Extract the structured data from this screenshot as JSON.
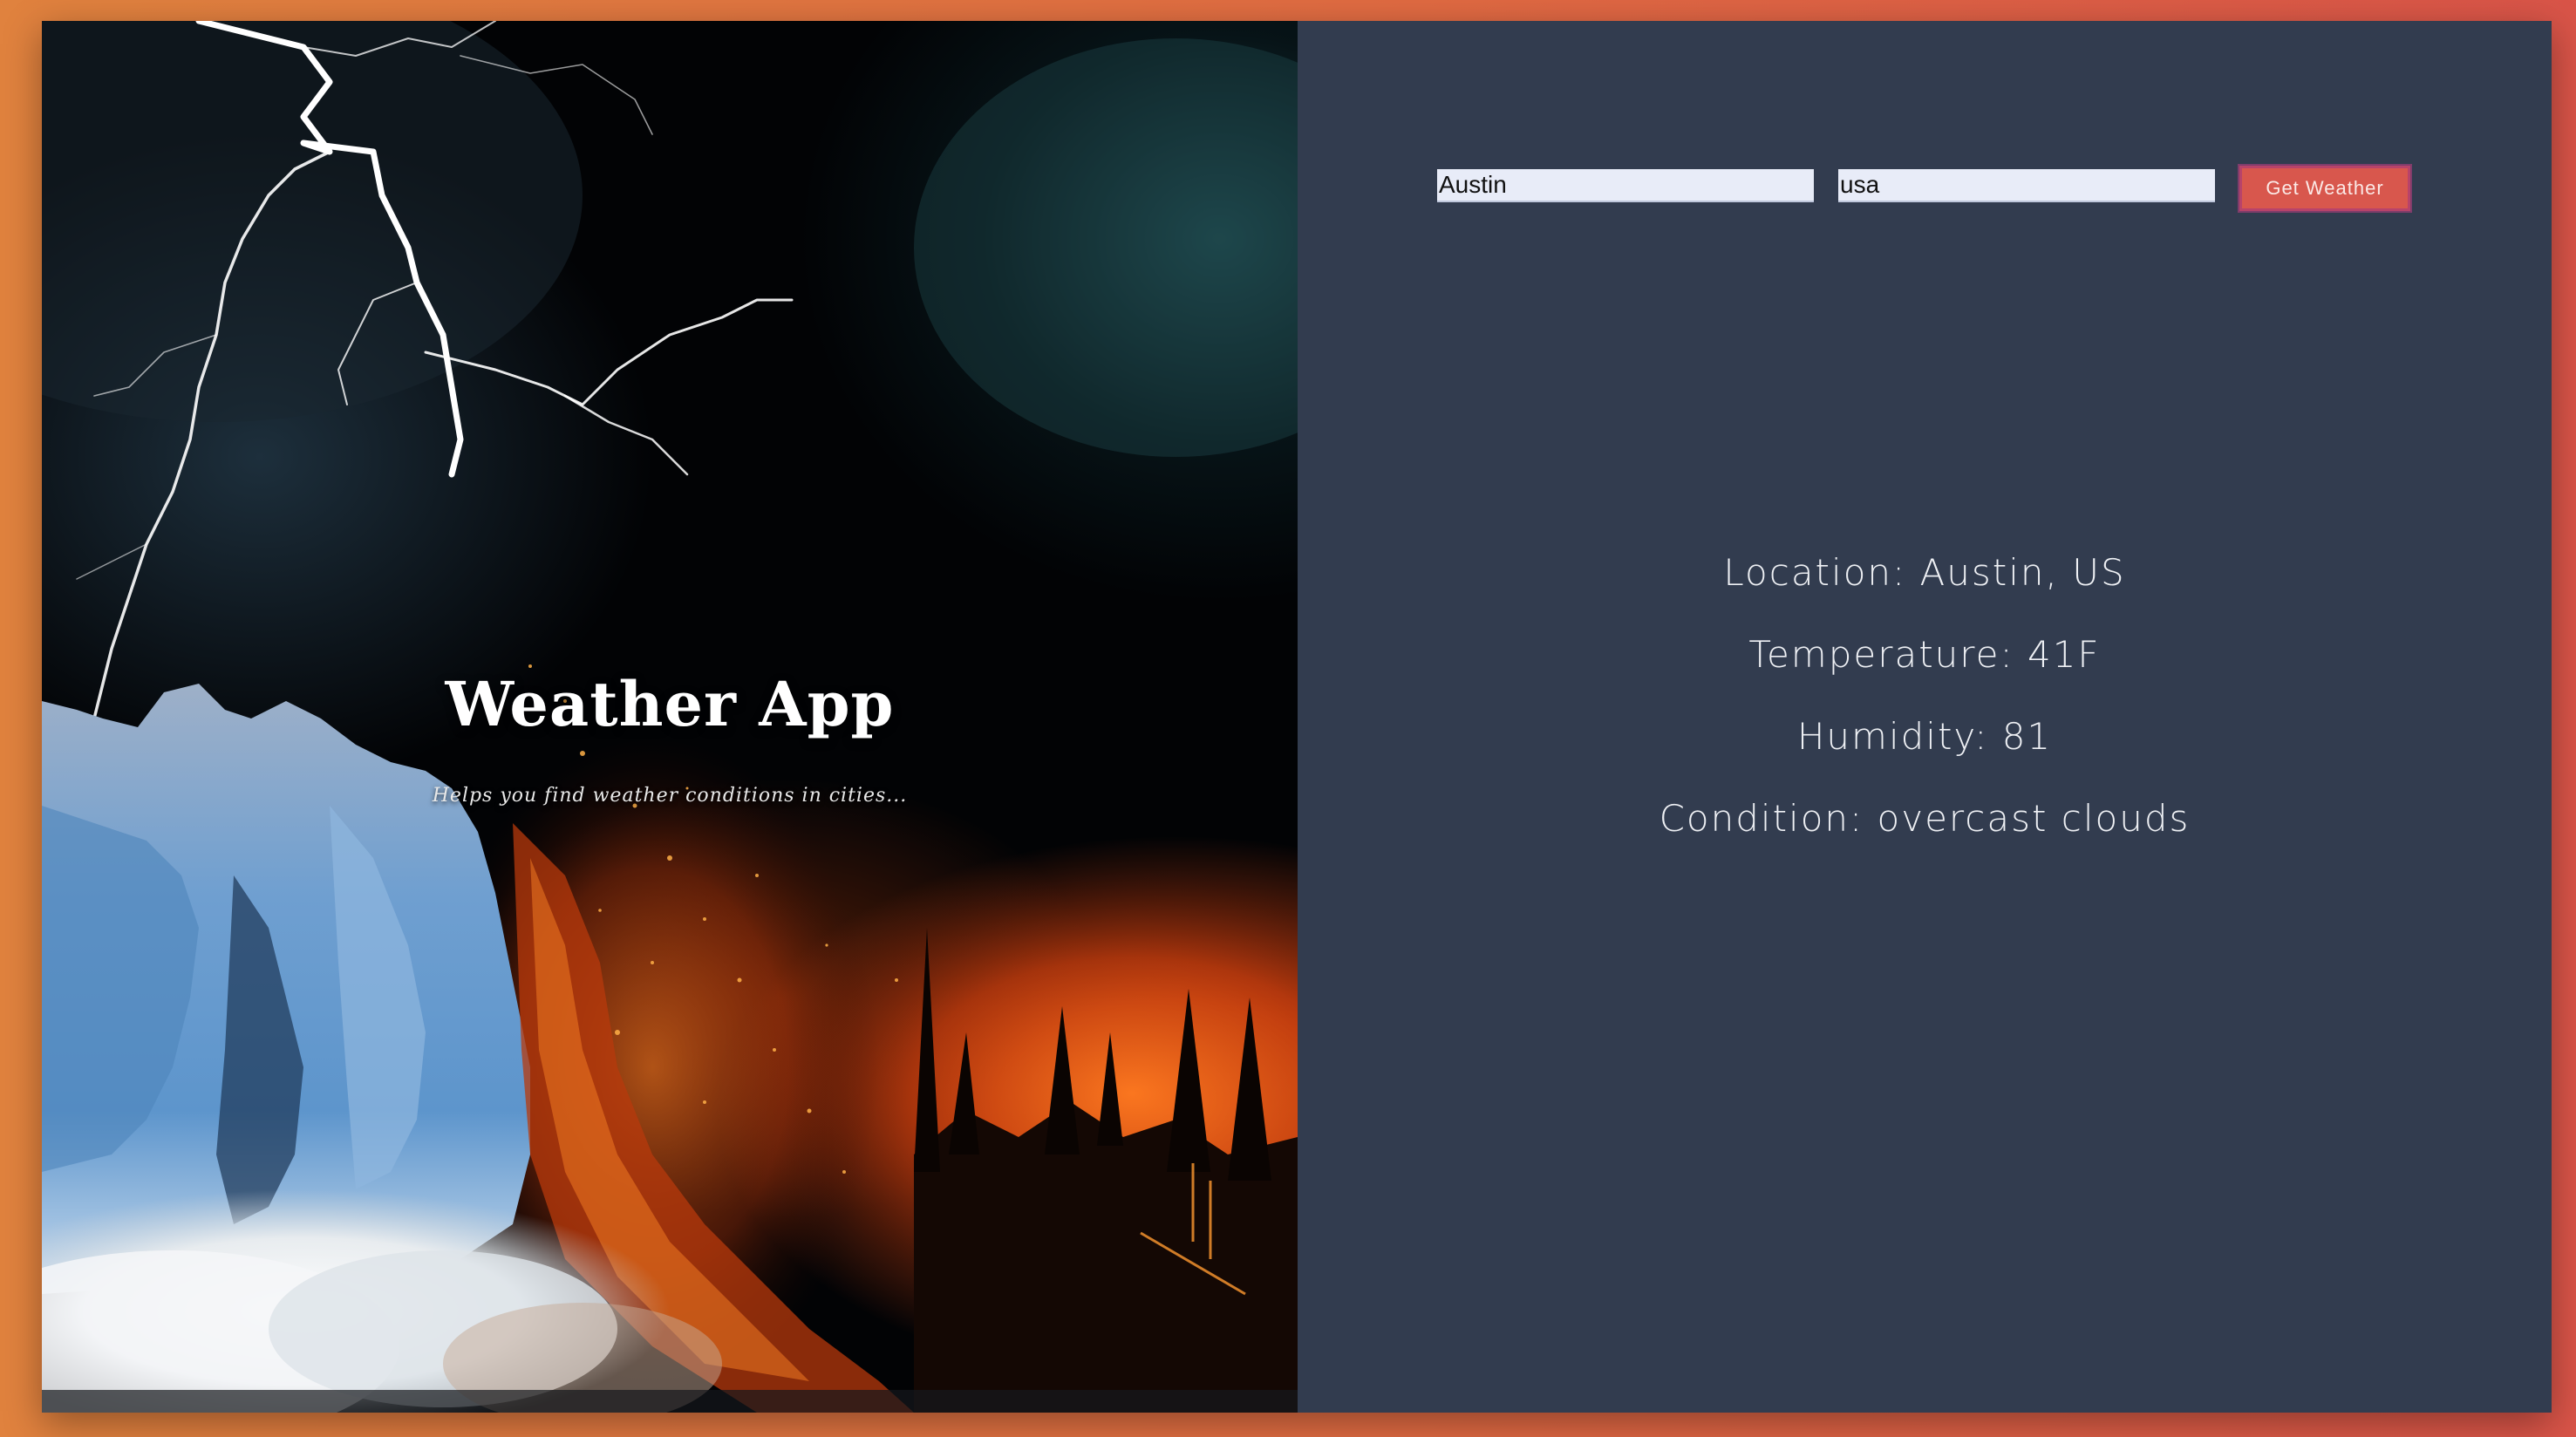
{
  "hero": {
    "title": "Weather App",
    "subtitle": "Helps you find weather conditions in cities..."
  },
  "form": {
    "city_value": "Austin",
    "country_value": "usa",
    "submit_label": "Get Weather"
  },
  "results": {
    "location": "Location: Austin, US",
    "temperature": "Temperature: 41F",
    "humidity": "Humidity: 81",
    "condition": "Condition: overcast clouds"
  },
  "colors": {
    "page_gradient_start": "#e0823e",
    "page_gradient_end": "#d95448",
    "panel_background": "#323c4f",
    "button_background": "#d8574d",
    "input_background": "#e8ecf8"
  }
}
